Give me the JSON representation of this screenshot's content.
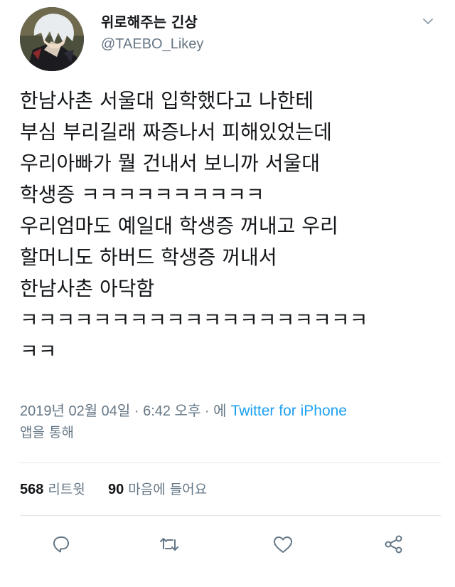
{
  "author": {
    "display_name": "위로해주는 긴상",
    "handle": "@TAEBO_Likey",
    "avatar_icon": "anime-avatar-icon"
  },
  "tweet": {
    "lines": [
      "한남사촌 서울대 입학했다고 나한테",
      "부심 부리길래 짜증나서 피해있었는데",
      "우리아빠가 뭘 건내서 보니까 서울대",
      "학생증 ㅋㅋㅋㅋㅋㅋㅋㅋㅋㅋ",
      "우리엄마도 예일대 학생증 꺼내고 우리",
      "할머니도 하버드 학생증 꺼내서",
      "한남사촌 아닥함",
      "ㅋㅋㅋㅋㅋㅋㅋㅋㅋㅋㅋㅋㅋㅋㅋㅋㅋㅋㅋ",
      "ㅋㅋ"
    ]
  },
  "meta": {
    "timestamp": "2019년 02월 04일 · 6:42 오후 · 에",
    "source": "Twitter for iPhone",
    "via": "앱을 통해"
  },
  "stats": {
    "retweets_count": "568",
    "retweets_label": "리트윗",
    "likes_count": "90",
    "likes_label": "마음에 들어요"
  },
  "actions": {
    "icons": [
      "reply-icon",
      "retweet-icon",
      "like-icon",
      "share-icon"
    ],
    "icon_color": "#657786"
  },
  "colors": {
    "link": "#1da1f2",
    "secondary_text": "#657786",
    "primary_text": "#14171a",
    "divider": "#e1e8ed"
  }
}
